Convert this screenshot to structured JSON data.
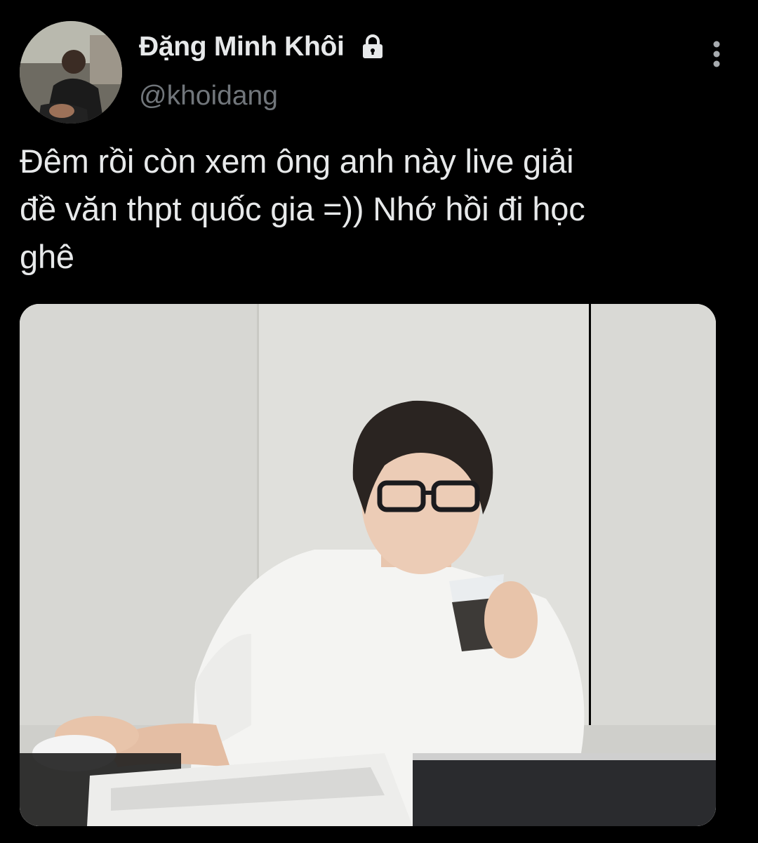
{
  "author": {
    "display_name": "Đặng Minh Khôi",
    "handle": "@khoidang",
    "protected_icon": "lock-icon",
    "avatar_icon": "avatar-photo"
  },
  "menu": {
    "icon": "more-vertical-icon"
  },
  "tweet": {
    "text": "Đêm rồi còn xem ông anh này live giải\nđề văn thpt quốc gia =)) Nhớ hồi đi học\nghê"
  },
  "media": {
    "type": "photo"
  },
  "colors": {
    "background": "#000000",
    "primary_text": "#e7e9ea",
    "secondary_text": "#71767b"
  }
}
